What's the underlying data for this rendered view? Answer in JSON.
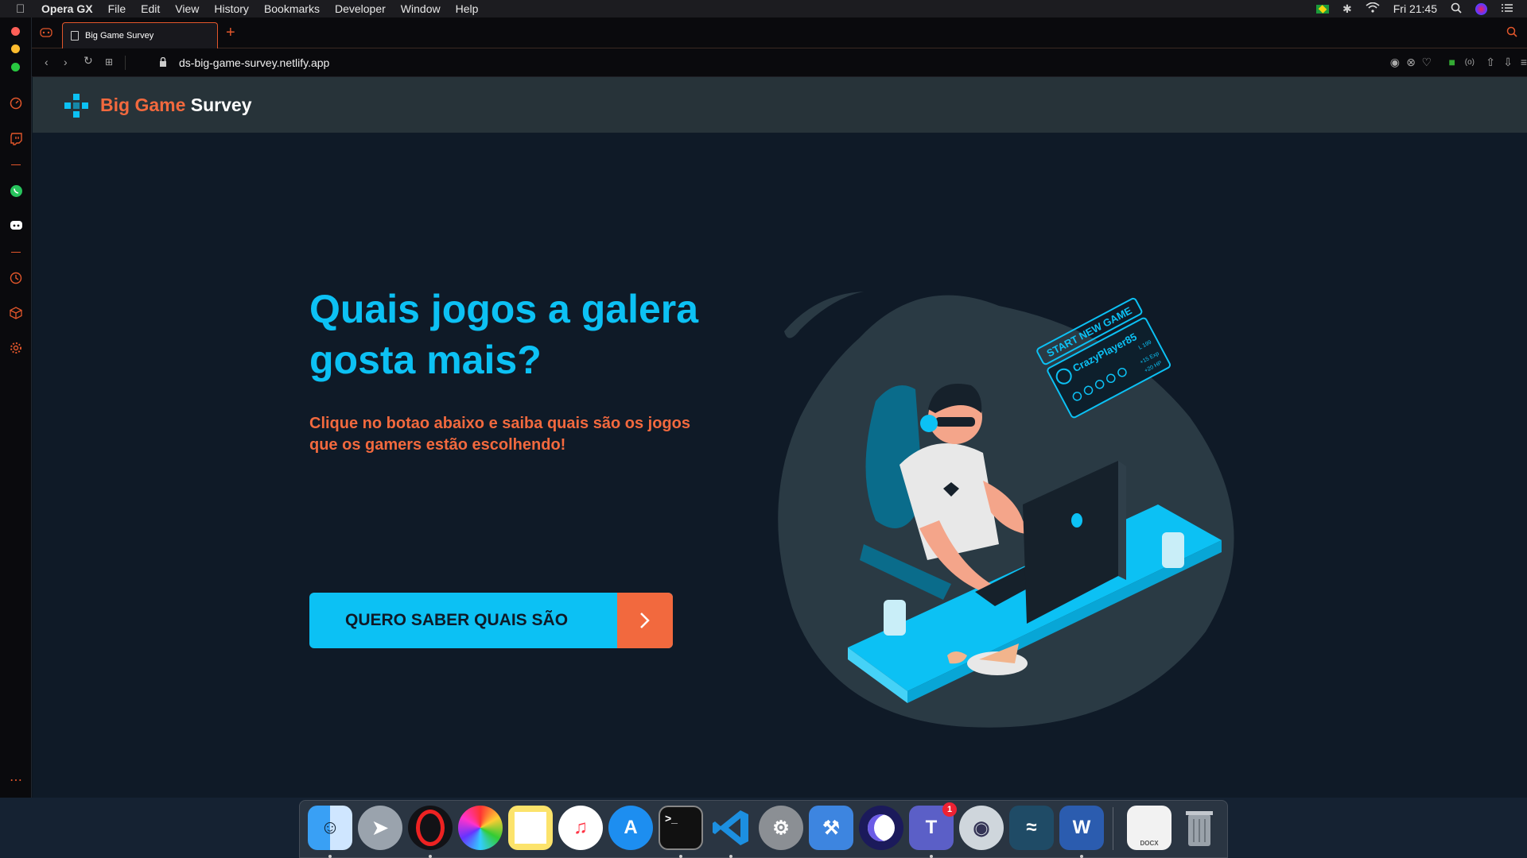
{
  "menubar": {
    "app": "Opera GX",
    "items": [
      "File",
      "Edit",
      "View",
      "History",
      "Bookmarks",
      "Developer",
      "Window",
      "Help"
    ],
    "clock": "Fri 21:45"
  },
  "browser": {
    "tab_title": "Big Game Survey",
    "url": "ds-big-game-survey.netlify.app"
  },
  "site": {
    "brand_part1": "Big Game",
    "brand_part2": "Survey",
    "headline": "Quais jogos a galera gosta mais?",
    "subtitle": "Clique no botao abaixo e saiba quais são os jogos que os gamers estão escolhendo!",
    "cta_label": "QUERO SABER QUAIS SÃO"
  },
  "illustration": {
    "hud_title": "START NEW GAME",
    "hud_player": "CrazyPlayer85",
    "hud_level": "L 199",
    "hud_xp": "+15 Exp",
    "hud_hp": "+20 HP"
  },
  "dock": {
    "items": [
      "Finder",
      "Launchpad",
      "Opera GX",
      "Photos",
      "Notes",
      "Music",
      "App Store",
      "Terminal",
      "Visual Studio Code",
      "System Preferences",
      "Xcode",
      "Beekeeper",
      "Microsoft Teams",
      "TablePlus",
      "MySQL Workbench",
      "Microsoft Word",
      "Document",
      "Trash"
    ],
    "teams_badge": "1",
    "doc_label": "DOCX"
  },
  "colors": {
    "accent_blue": "#0cc1f4",
    "accent_orange": "#f2693e",
    "navbar": "#273339",
    "page_bg": "#0f1a27"
  }
}
